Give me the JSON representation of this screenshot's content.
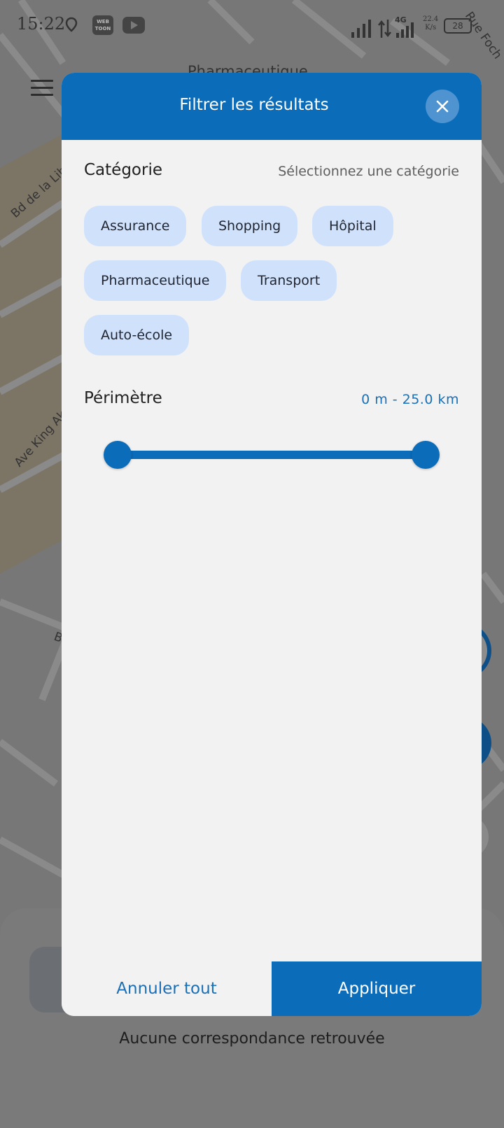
{
  "status_bar": {
    "time": "15:22",
    "webtoon_label": "WEB TOON",
    "network": "4G",
    "speed_top": "22.4",
    "speed_bottom": "K/s",
    "battery": "28"
  },
  "map": {
    "street_labels": [
      "Pharmaceutique",
      "Bd de la Libé",
      "Ave King Akwa",
      "Bd",
      "Rue Foch"
    ]
  },
  "modal": {
    "title": "Filtrer les résultats",
    "close_icon": "close-icon",
    "category": {
      "label": "Catégorie",
      "hint": "Sélectionnez une catégorie",
      "chips": [
        "Assurance",
        "Shopping",
        "Hôpital",
        "Pharmaceutique",
        "Transport",
        "Auto-école"
      ]
    },
    "perimeter": {
      "label": "Périmètre",
      "value_text": "0 m - 25.0 km",
      "range_min_fraction": 0.0,
      "range_max_fraction": 1.0
    },
    "footer": {
      "cancel_label": "Annuler tout",
      "apply_label": "Appliquer"
    }
  },
  "background": {
    "empty_message": "Aucune correspondance retrouvée"
  },
  "colors": {
    "primary": "#0b6cba",
    "chip_bg": "#d0e2fb",
    "modal_bg": "#f2f2f2",
    "scrim": "#7a7a7a"
  }
}
